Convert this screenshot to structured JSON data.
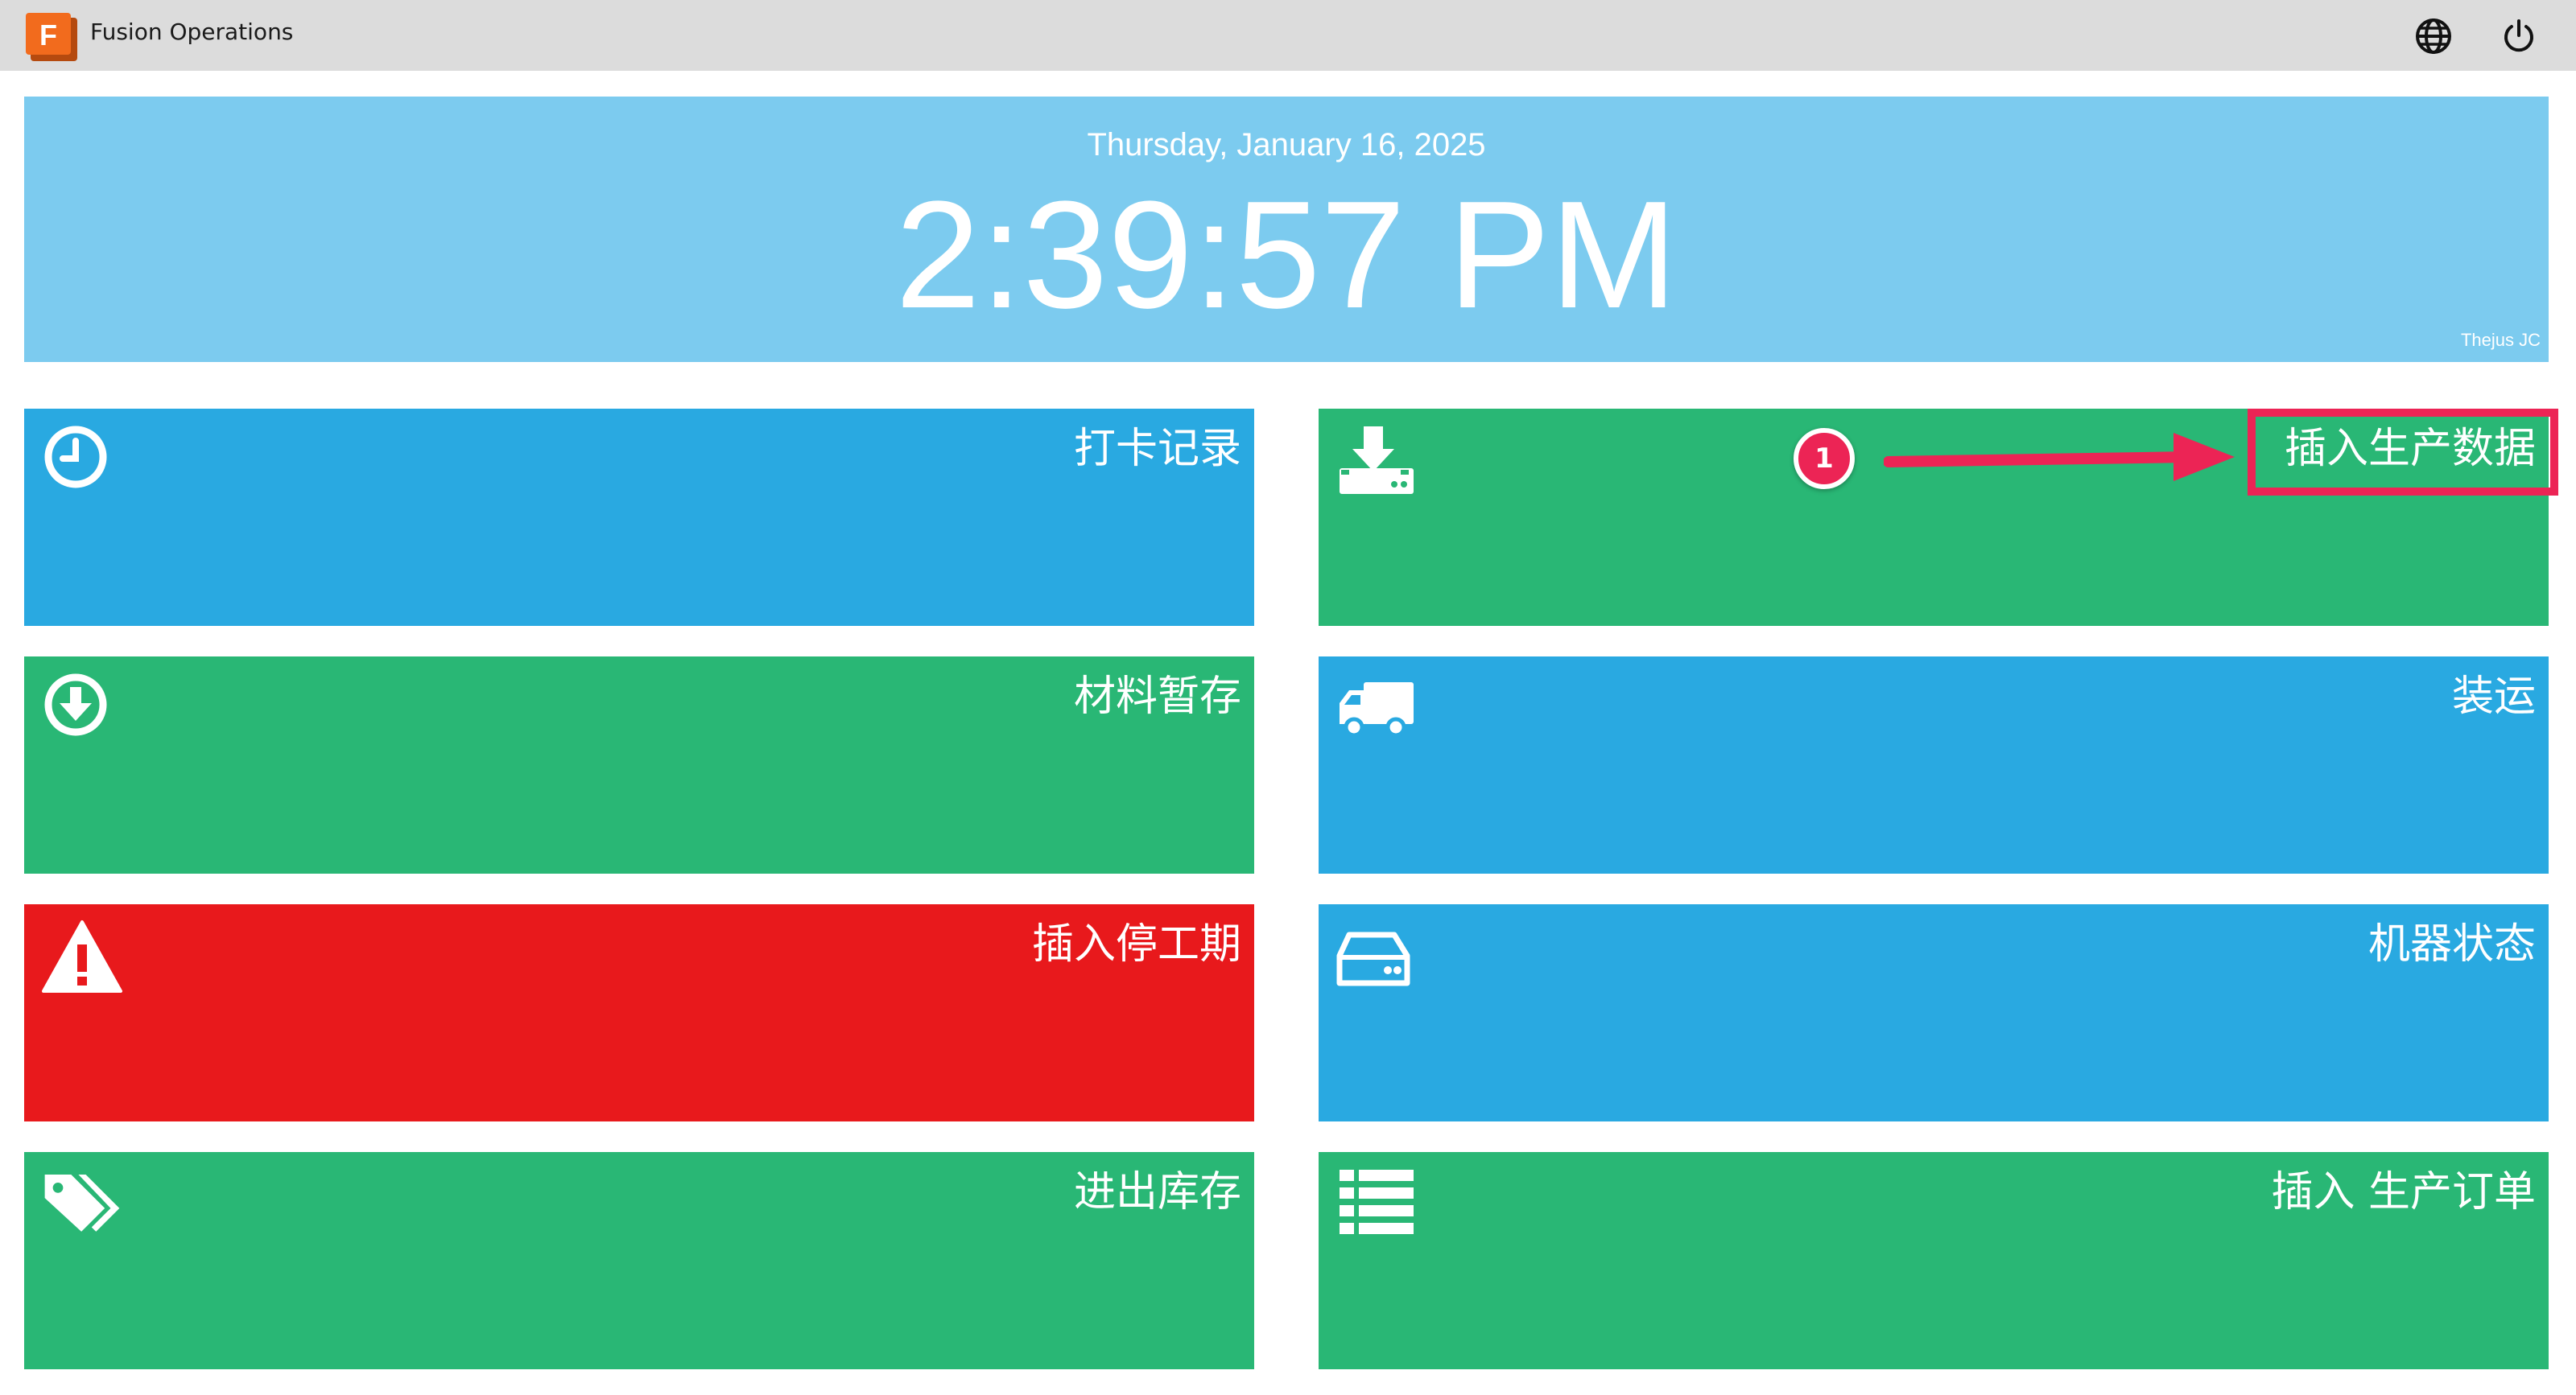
{
  "app": {
    "title": "Fusion Operations",
    "logo_letter": "F"
  },
  "header": {
    "globe_icon": "globe-icon",
    "power_icon": "power-icon"
  },
  "clock": {
    "date": "Thursday, January 16, 2025",
    "time": "2:39:57 PM",
    "user": "Thejus JC"
  },
  "tiles": [
    {
      "label": "打卡记录",
      "icon": "clock-icon",
      "color": "#29a9e1"
    },
    {
      "label": "插入生产数据",
      "icon": "download-drive-icon",
      "color": "#29b775"
    },
    {
      "label": "材料暂存",
      "icon": "download-circle-icon",
      "color": "#29b775"
    },
    {
      "label": "装运",
      "icon": "truck-icon",
      "color": "#29a9e1"
    },
    {
      "label": "插入停工期",
      "icon": "warning-icon",
      "color": "#e8191c"
    },
    {
      "label": "机器状态",
      "icon": "hard-drive-icon",
      "color": "#29a9e1"
    },
    {
      "label": "进出库存",
      "icon": "tags-icon",
      "color": "#29b775"
    },
    {
      "label": "插入 生产订单",
      "icon": "list-icon",
      "color": "#29b775"
    }
  ],
  "annotation": {
    "step_number": "1",
    "color": "#ec2455"
  },
  "colors": {
    "topbar": "#dcdcdc",
    "clock_banner": "#7ccbef",
    "blue_tile": "#29a9e1",
    "green_tile": "#29b775",
    "red_tile": "#e8191c"
  }
}
